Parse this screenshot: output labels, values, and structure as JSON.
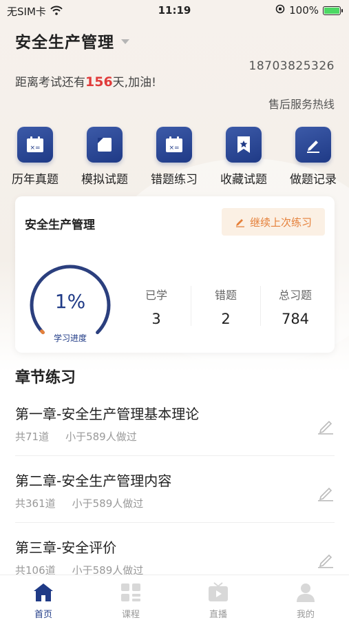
{
  "status_bar": {
    "carrier": "无SIM卡",
    "time": "11:19",
    "battery": "100%"
  },
  "header": {
    "subject": "安全生产管理",
    "phone": "18703825326",
    "countdown_prefix": "距离考试还有",
    "countdown_days": "156",
    "countdown_suffix": "天,加油!",
    "hotline": "售后服务热线"
  },
  "features": [
    {
      "label": "历年真题",
      "icon": "calendar-icon"
    },
    {
      "label": "模拟试题",
      "icon": "page-icon"
    },
    {
      "label": "错题练习",
      "icon": "calendar-icon"
    },
    {
      "label": "收藏试题",
      "icon": "bookmark-star-icon"
    },
    {
      "label": "做题记录",
      "icon": "pencil-icon"
    }
  ],
  "progress_card": {
    "title": "安全生产管理",
    "continue_label": "继续上次练习",
    "progress_value": "1%",
    "progress_fraction": 0.01,
    "progress_label": "学习进度",
    "stats": [
      {
        "label": "已学",
        "value": "3"
      },
      {
        "label": "错题",
        "value": "2"
      },
      {
        "label": "总习题",
        "value": "784"
      }
    ]
  },
  "chapters": {
    "section_title": "章节练习",
    "items": [
      {
        "title": "第一章-安全生产管理基本理论",
        "count": "共71道",
        "people": "小于589人做过"
      },
      {
        "title": "第二章-安全生产管理内容",
        "count": "共361道",
        "people": "小于589人做过"
      },
      {
        "title": "第三章-安全评价",
        "count": "共106道",
        "people": "小于589人做过"
      }
    ]
  },
  "tabbar": {
    "items": [
      {
        "label": "首页",
        "icon": "home-icon",
        "active": true
      },
      {
        "label": "课程",
        "icon": "grid-icon",
        "active": false
      },
      {
        "label": "直播",
        "icon": "tv-icon",
        "active": false
      },
      {
        "label": "我的",
        "icon": "user-icon",
        "active": false
      }
    ]
  },
  "colors": {
    "brand": "#1f3a86",
    "accent": "#e5803a",
    "countdown": "#e03b3b"
  }
}
